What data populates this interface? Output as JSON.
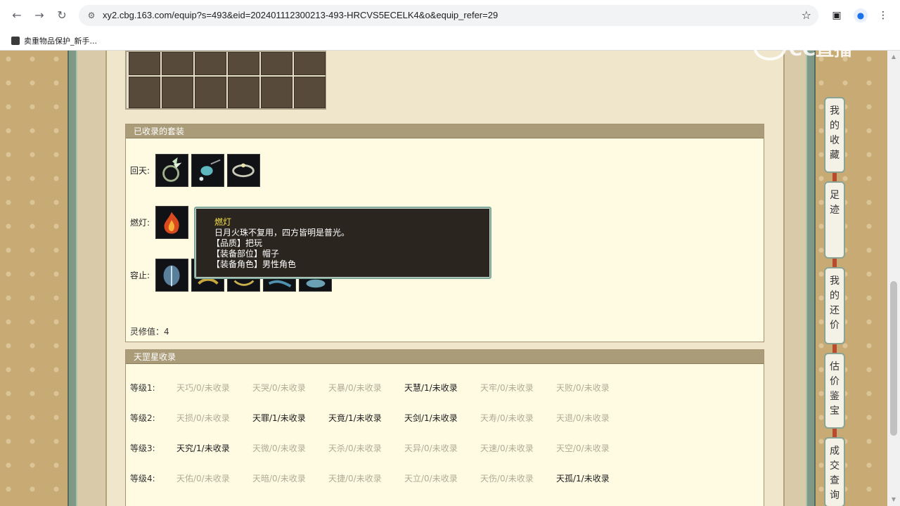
{
  "browser": {
    "url": "xy2.cbg.163.com/equip?s=493&eid=202401112300213-493-HRCVS5ECELK4&o&equip_refer=29",
    "bookmark": "卖重物品保护_新手..."
  },
  "watermark": "CC直播",
  "suits": {
    "title": "已收录的套装",
    "rows": [
      {
        "label": "回天:"
      },
      {
        "label": "燃灯:"
      },
      {
        "label": "容止:"
      }
    ],
    "lingxiu": "灵修值：4"
  },
  "tooltip": {
    "title": "燃灯",
    "desc": "日月火珠不复用，四方皆明是普光。",
    "quality": "【品质】把玩",
    "slot": "【装备部位】帽子",
    "role": "【装备角色】男性角色"
  },
  "tiangang": {
    "title": "天罡星收录",
    "rows": [
      {
        "level": "等级1:",
        "cells": [
          {
            "text": "天巧/0/未收录",
            "on": false
          },
          {
            "text": "天哭/0/未收录",
            "on": false
          },
          {
            "text": "天暴/0/未收录",
            "on": false
          },
          {
            "text": "天慧/1/未收录",
            "on": true
          },
          {
            "text": "天牢/0/未收录",
            "on": false
          },
          {
            "text": "天败/0/未收录",
            "on": false
          }
        ]
      },
      {
        "level": "等级2:",
        "cells": [
          {
            "text": "天损/0/未收录",
            "on": false
          },
          {
            "text": "天罪/1/未收录",
            "on": true
          },
          {
            "text": "天竟/1/未收录",
            "on": true
          },
          {
            "text": "天剑/1/未收录",
            "on": true
          },
          {
            "text": "天寿/0/未收录",
            "on": false
          },
          {
            "text": "天退/0/未收录",
            "on": false
          }
        ]
      },
      {
        "level": "等级3:",
        "cells": [
          {
            "text": "天究/1/未收录",
            "on": true
          },
          {
            "text": "天微/0/未收录",
            "on": false
          },
          {
            "text": "天杀/0/未收录",
            "on": false
          },
          {
            "text": "天异/0/未收录",
            "on": false
          },
          {
            "text": "天速/0/未收录",
            "on": false
          },
          {
            "text": "天空/0/未收录",
            "on": false
          }
        ]
      },
      {
        "level": "等级4:",
        "cells": [
          {
            "text": "天佑/0/未收录",
            "on": false
          },
          {
            "text": "天暗/0/未收录",
            "on": false
          },
          {
            "text": "天捷/0/未收录",
            "on": false
          },
          {
            "text": "天立/0/未收录",
            "on": false
          },
          {
            "text": "天伤/0/未收录",
            "on": false
          },
          {
            "text": "天孤/1/未收录",
            "on": true
          }
        ]
      }
    ]
  },
  "side_tabs": [
    "我的收藏",
    "足迹",
    "我的还价",
    "估价鉴宝",
    "成交查询"
  ]
}
